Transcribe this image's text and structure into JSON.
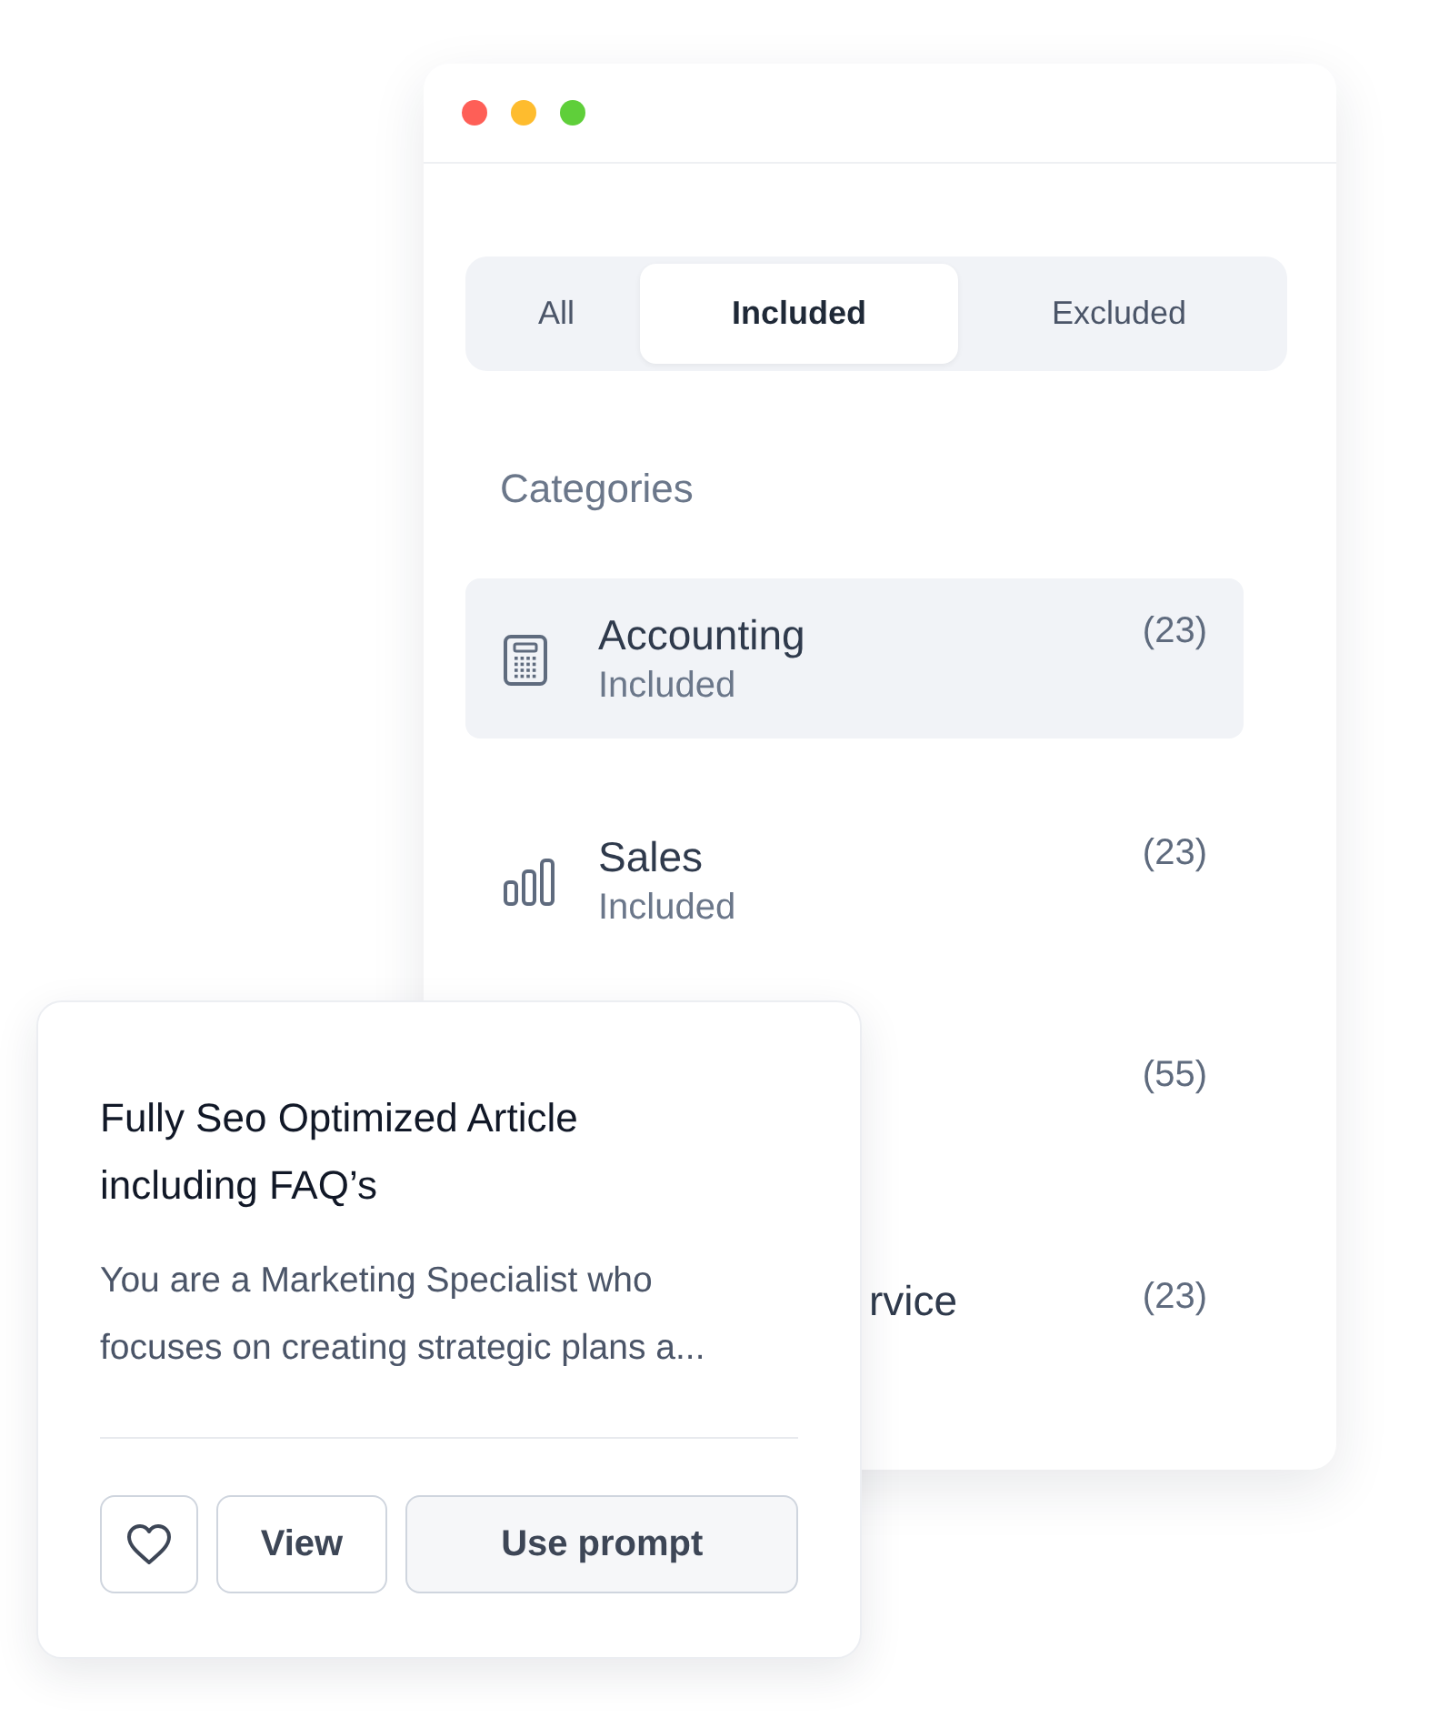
{
  "window": {
    "dots": [
      {
        "color": "#fe5f57"
      },
      {
        "color": "#febc2e"
      },
      {
        "color": "#5fcf3a"
      }
    ]
  },
  "tabs": [
    {
      "label": "All",
      "selected": false
    },
    {
      "label": "Included",
      "selected": true
    },
    {
      "label": "Excluded",
      "selected": false
    }
  ],
  "section_title": "Categories",
  "categories": [
    {
      "kind": "calculator",
      "name": "Accounting",
      "status": "Included",
      "count": "(23)",
      "selected": true,
      "covered": false
    },
    {
      "kind": "chart",
      "name": "Sales",
      "status": "Included",
      "count": "(23)",
      "selected": false,
      "covered": false
    },
    {
      "count": "(55)",
      "selected": false,
      "covered": true
    },
    {
      "name": "rvice",
      "count": "(23)",
      "selected": false,
      "covered": true
    }
  ],
  "prompt_card": {
    "title": "Fully Seo Optimized Article including FAQ’s",
    "description": "You are a Marketing Specialist who focuses on creating strategic plans a...",
    "buttons": [
      {
        "kind": "favorite"
      },
      {
        "kind": "text",
        "label": "View"
      },
      {
        "kind": "primary",
        "label": "Use prompt"
      }
    ]
  }
}
